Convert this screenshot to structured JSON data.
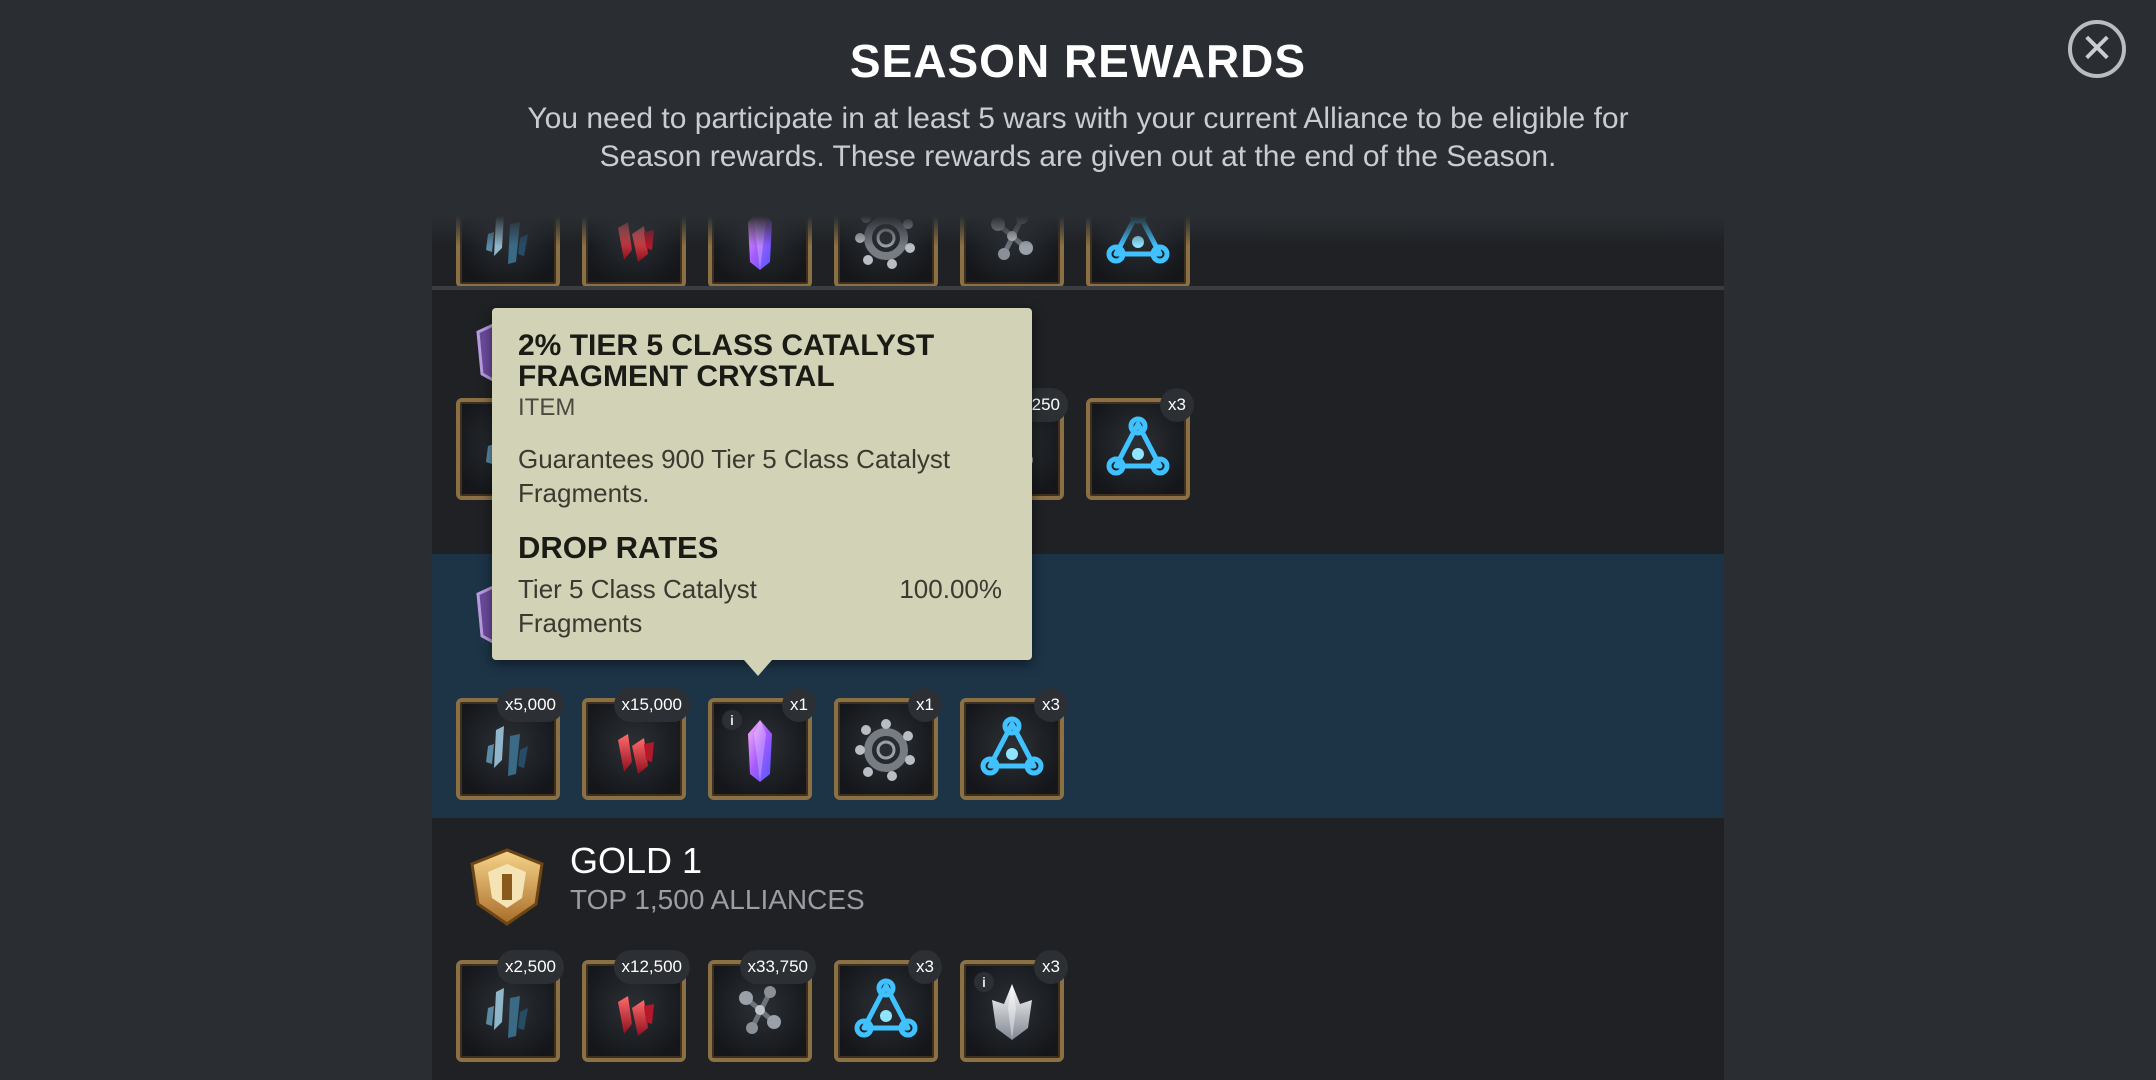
{
  "header": {
    "title": "SEASON REWARDS",
    "subtitle": "You need to participate in at least 5 wars with your current Alliance to be eligible for Season rewards. These rewards are given out at the end of the Season.",
    "close_icon": "close-icon"
  },
  "colors": {
    "background": "#2a2d32",
    "row_dark": "#1f2124",
    "row_highlight": "#1d3447",
    "tooltip_bg": "#d2d2b7",
    "item_border": "#8b7043"
  },
  "tiers": {
    "top": {
      "items": [
        {
          "icon": "shards-icon"
        },
        {
          "icon": "red-crystal-icon"
        },
        {
          "icon": "purple-crystal-icon"
        },
        {
          "icon": "catalyst-wheel-icon"
        },
        {
          "icon": "gear-fragments-icon"
        },
        {
          "icon": "blue-node-icon"
        }
      ]
    },
    "platinum_2": {
      "items": [
        {
          "icon": "shards-icon"
        },
        {
          "icon": "gear-fragments-icon",
          "qty": ",250"
        },
        {
          "icon": "blue-node-icon",
          "qty": "x3"
        }
      ]
    },
    "platinum_1": {
      "items": [
        {
          "icon": "shards-icon",
          "qty": "x5,000"
        },
        {
          "icon": "red-crystal-icon",
          "qty": "x15,000"
        },
        {
          "icon": "purple-crystal-icon",
          "qty": "x1"
        },
        {
          "icon": "catalyst-wheel-icon",
          "qty": "x1"
        },
        {
          "icon": "blue-node-icon",
          "qty": "x3"
        }
      ]
    },
    "gold_1": {
      "name": "GOLD 1",
      "subtitle": "TOP 1,500 ALLIANCES",
      "badge_icon": "gold-badge-icon",
      "items": [
        {
          "icon": "shards-icon",
          "qty": "x2,500"
        },
        {
          "icon": "red-crystal-icon",
          "qty": "x12,500"
        },
        {
          "icon": "gear-fragments-icon",
          "qty": "x33,750"
        },
        {
          "icon": "blue-node-icon",
          "qty": "x3"
        },
        {
          "icon": "silver-crystal-icon",
          "qty": "x3"
        }
      ]
    }
  },
  "tooltip": {
    "title": "2% TIER 5 CLASS CATALYST FRAGMENT CRYSTAL",
    "type": "ITEM",
    "description": "Guarantees 900 Tier 5 Class Catalyst Fragments.",
    "drop_rates_heading": "DROP RATES",
    "drop_rates": [
      {
        "name": "Tier 5 Class Catalyst Fragments",
        "rate": "100.00%"
      }
    ]
  },
  "info_glyph": "i"
}
